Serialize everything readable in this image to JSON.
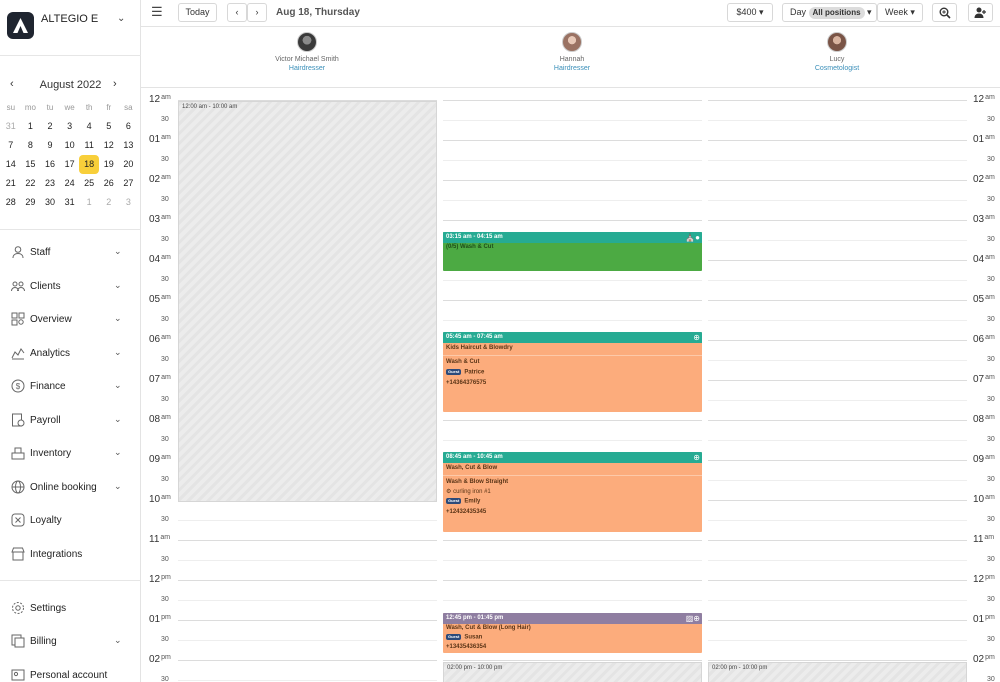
{
  "brand": {
    "name": "ALTEGIO E"
  },
  "calendar": {
    "month": "August 2022",
    "weekdays": [
      "su",
      "mo",
      "tu",
      "we",
      "th",
      "fr",
      "sa"
    ],
    "days": [
      [
        "31",
        "1",
        "2",
        "3",
        "4",
        "5",
        "6"
      ],
      [
        "7",
        "8",
        "9",
        "10",
        "11",
        "12",
        "13"
      ],
      [
        "14",
        "15",
        "16",
        "17",
        "18",
        "19",
        "20"
      ],
      [
        "21",
        "22",
        "23",
        "24",
        "25",
        "26",
        "27"
      ],
      [
        "28",
        "29",
        "30",
        "31",
        "1",
        "2",
        "3"
      ]
    ],
    "selected": "18"
  },
  "nav": {
    "staff": "Staff",
    "clients": "Clients",
    "overview": "Overview",
    "analytics": "Analytics",
    "finance": "Finance",
    "payroll": "Payroll",
    "inventory": "Inventory",
    "online_booking": "Online booking",
    "loyalty": "Loyalty",
    "integrations": "Integrations",
    "settings": "Settings",
    "billing": "Billing",
    "personal_account": "Personal account"
  },
  "toolbar": {
    "today": "Today",
    "date": "Aug 18, Thursday",
    "revenue": "$400",
    "day": "Day",
    "positions": "All positions",
    "week": "Week"
  },
  "staff": [
    {
      "name": "Victor Michael Smith",
      "role": "Hairdresser"
    },
    {
      "name": "Hannah",
      "role": "Hairdresser"
    },
    {
      "name": "Lucy",
      "role": "Cosmetologist"
    }
  ],
  "hours": [
    {
      "h": "12",
      "ap": "am"
    },
    {
      "h": "01",
      "ap": "am"
    },
    {
      "h": "02",
      "ap": "am"
    },
    {
      "h": "03",
      "ap": "am"
    },
    {
      "h": "04",
      "ap": "am"
    },
    {
      "h": "05",
      "ap": "am"
    },
    {
      "h": "06",
      "ap": "am"
    },
    {
      "h": "07",
      "ap": "am"
    },
    {
      "h": "08",
      "ap": "am"
    },
    {
      "h": "09",
      "ap": "am"
    },
    {
      "h": "10",
      "ap": "am"
    },
    {
      "h": "11",
      "ap": "am"
    },
    {
      "h": "12",
      "ap": "pm"
    },
    {
      "h": "01",
      "ap": "pm"
    },
    {
      "h": "02",
      "ap": "pm"
    }
  ],
  "half_label": "30",
  "blocks": {
    "victor_off": "12:00 am - 10:00 am",
    "hannah_off": "02:00 pm - 10:00 pm",
    "lucy_off": "02:00 pm - 10:00 pm"
  },
  "appointments": {
    "a1": {
      "time": "03:15 am - 04:15 am",
      "lines": [
        "(0/5) Wash & Cut"
      ]
    },
    "a2": {
      "time": "05:45 am - 07:45 am",
      "lines": [
        "Kids Haircut & Blowdry",
        "Wash & Cut"
      ],
      "tag": "Guest",
      "client": "Patrice",
      "phone": "+14364376575"
    },
    "a3": {
      "time": "08:45 am - 10:45 am",
      "lines": [
        "Wash, Cut & Blow",
        "Wash & Blow Straight"
      ],
      "resource": "curling iron #1",
      "tag": "Guest",
      "client": "Emily",
      "phone": "+12432435345"
    },
    "a4": {
      "time": "12:45 pm - 01:45 pm",
      "lines": [
        "Wash, Cut & Blow (Long Hair)"
      ],
      "tag": "Guest",
      "client": "Susan",
      "phone": "+13435436354"
    }
  },
  "colors": {
    "teal": "#26ab93",
    "green": "#4caa43",
    "orange": "#fcac7c",
    "purple": "#8f7ea1",
    "selected_day": "#f8cf3a"
  }
}
